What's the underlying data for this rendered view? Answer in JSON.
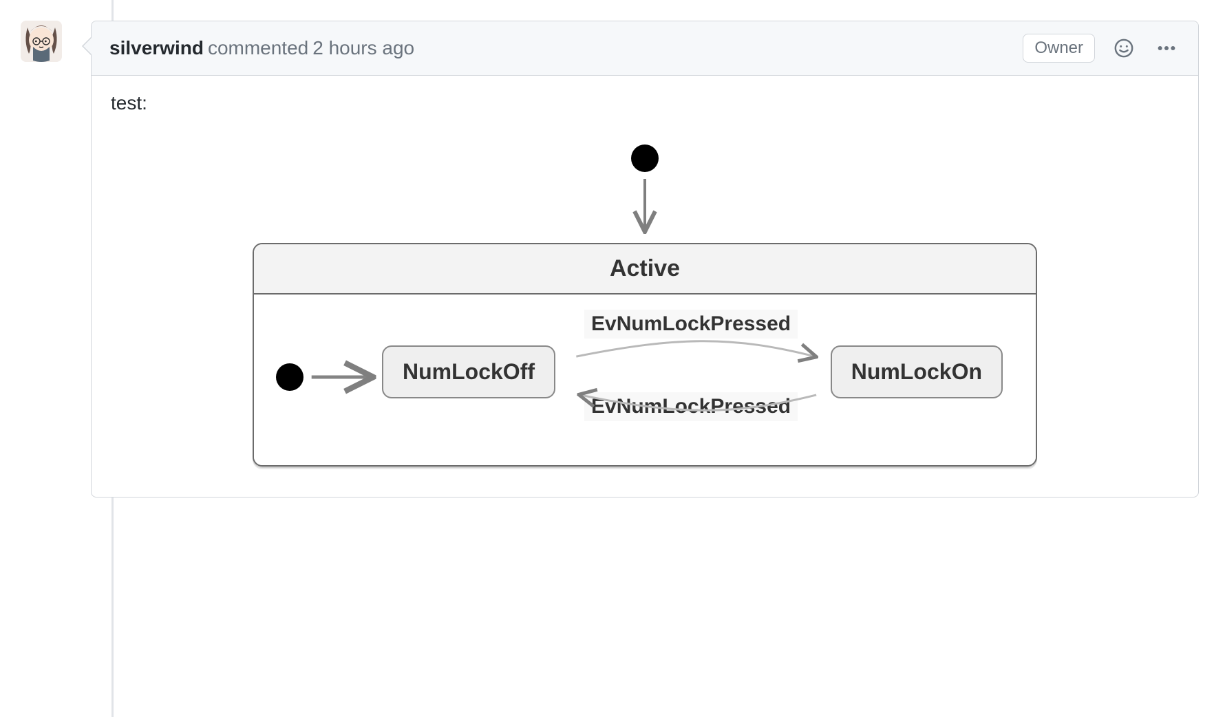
{
  "comment": {
    "author": "silverwind",
    "commented_label": "commented",
    "timestamp": "2 hours ago",
    "owner_badge": "Owner",
    "body_text": "test:"
  },
  "diagram": {
    "title": "Active",
    "state_left": "NumLockOff",
    "state_right": "NumLockOn",
    "transition_top": "EvNumLockPressed",
    "transition_bottom": "EvNumLockPressed"
  }
}
